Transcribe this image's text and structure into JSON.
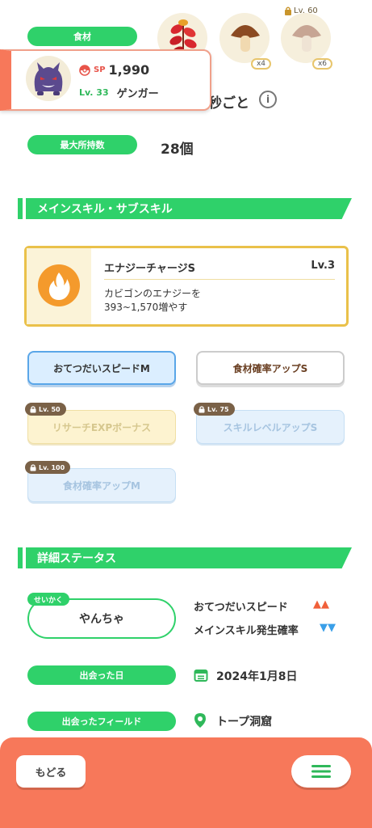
{
  "ingredients": {
    "label": "食材",
    "items": [
      {
        "icon": "fiery-herb-icon",
        "qty": ""
      },
      {
        "icon": "mushroom-icon",
        "qty": "x4"
      },
      {
        "icon": "mushroom-locked-icon",
        "qty": "x6",
        "lock_level": "Lv. 60"
      }
    ]
  },
  "pokemon_card": {
    "sp_label": "SP",
    "sp_value": "1,990",
    "level": "Lv. 33",
    "name": "ゲンガー"
  },
  "help_interval_text": "秒ごと",
  "max_carry": {
    "label": "最大所持数",
    "value": "28個"
  },
  "skills_section": {
    "title": "メインスキル・サブスキル",
    "main_skill": {
      "name": "エナジーチャージS",
      "level": "Lv.3",
      "desc_line1": "カビゴンのエナジーを",
      "desc_line2": "393~1,570増やす"
    },
    "sub_skills": [
      {
        "label": "おてつだいスピードM",
        "lock": ""
      },
      {
        "label": "食材確率アップS",
        "lock": ""
      },
      {
        "label": "リサーチEXPボーナス",
        "lock": "Lv. 50"
      },
      {
        "label": "スキルレベルアップS",
        "lock": "Lv. 75"
      },
      {
        "label": "食材確率アップM",
        "lock": "Lv. 100"
      }
    ]
  },
  "details_section": {
    "title": "詳細ステータス",
    "nature_tag": "せいかく",
    "nature": "やんちゃ",
    "up_stat": "おてつだいスピード",
    "up_marks": "▲▲",
    "down_stat": "メインスキル発生確率",
    "down_marks": "▼▼",
    "met_date_label": "出会った日",
    "met_date": "2024年1月8日",
    "met_field_label": "出会ったフィールド",
    "met_field": "トープ洞窟"
  },
  "bottom_bar": {
    "back_label": "もどる"
  },
  "colors": {
    "accent_green": "#2fd16a",
    "accent_orange": "#f7785a",
    "gold": "#eac14a"
  }
}
